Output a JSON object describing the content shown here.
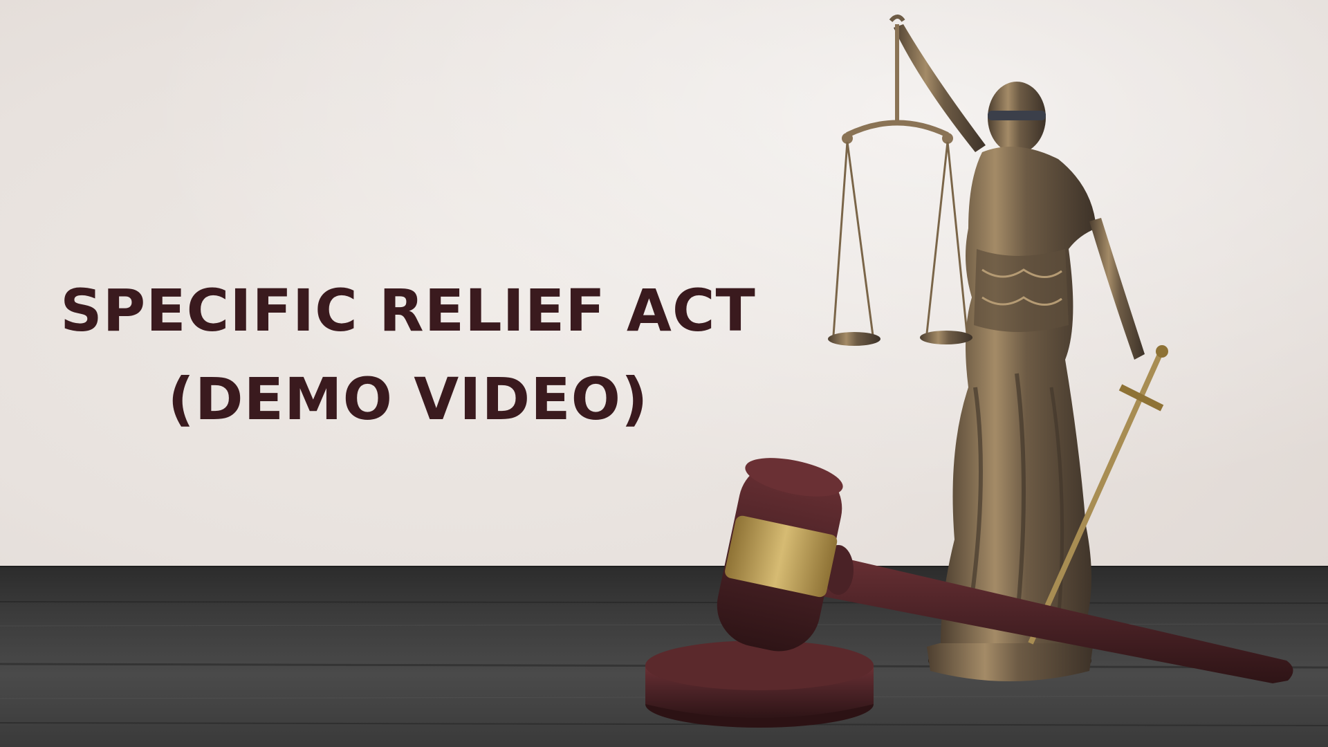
{
  "thumbnail": {
    "title_line_1": "SPECIFIC RELIEF ACT",
    "title_line_2": "(DEMO VIDEO)"
  },
  "colors": {
    "title_text": "#3a1a1e",
    "background": "#ece7e3",
    "table": "#3b3b3b",
    "bronze": "#8a7355",
    "gavel_wood": "#4a2226",
    "gavel_band": "#b99a52"
  },
  "icons": {
    "statue": "lady-justice-statue-icon",
    "scales": "scales-of-justice-icon",
    "gavel": "gavel-icon"
  }
}
